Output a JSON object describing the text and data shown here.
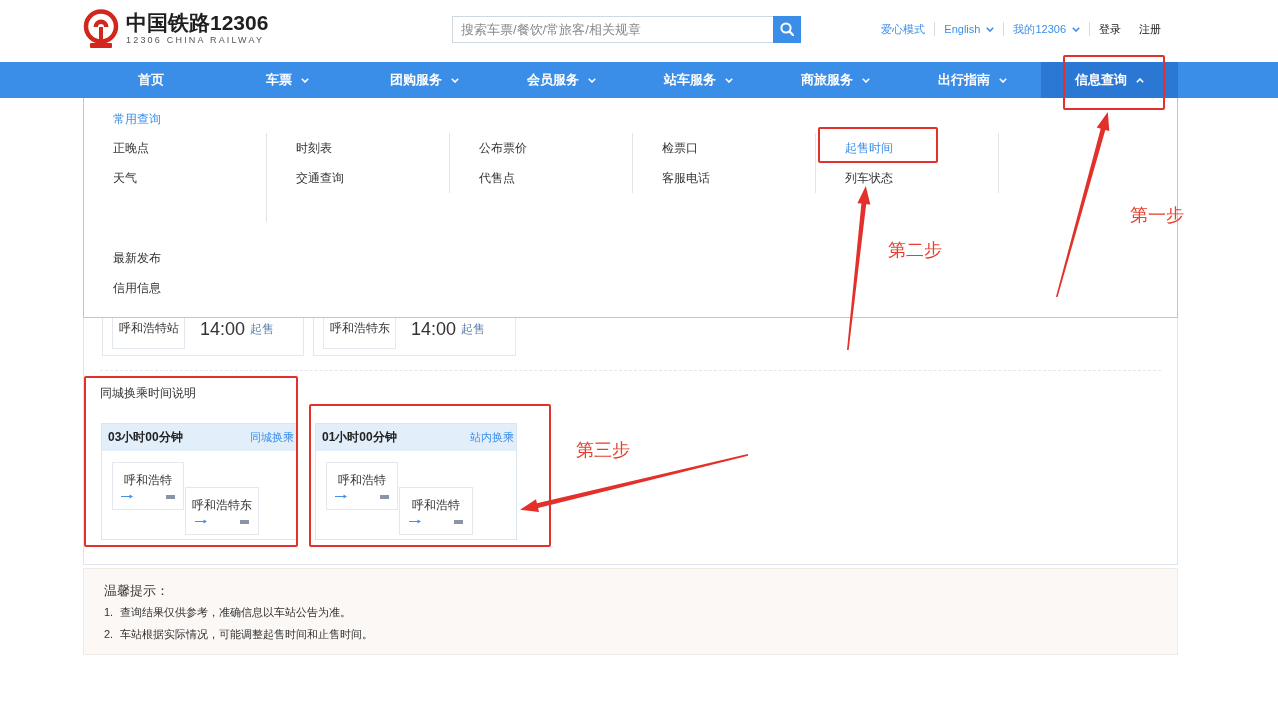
{
  "header": {
    "logo": {
      "title": "中国铁路12306",
      "subtitle": "12306 CHINA RAILWAY"
    },
    "search": {
      "placeholder": "搜索车票/餐饮/常旅客/相关规章"
    },
    "links": [
      {
        "label": "爱心模式",
        "kind": "link"
      },
      {
        "label": "English",
        "kind": "dropdown"
      },
      {
        "label": "我的12306",
        "kind": "dropdown"
      },
      {
        "label": "登录",
        "kind": "auth"
      },
      {
        "label": "注册",
        "kind": "auth"
      }
    ]
  },
  "nav": [
    {
      "label": "首页",
      "kind": "link",
      "selected": false,
      "expanded": false
    },
    {
      "label": "车票",
      "kind": "menu",
      "selected": false,
      "expanded": false
    },
    {
      "label": "团购服务",
      "kind": "menu",
      "selected": false,
      "expanded": false
    },
    {
      "label": "会员服务",
      "kind": "menu",
      "selected": false,
      "expanded": false
    },
    {
      "label": "站车服务",
      "kind": "menu",
      "selected": false,
      "expanded": false
    },
    {
      "label": "商旅服务",
      "kind": "menu",
      "selected": false,
      "expanded": false
    },
    {
      "label": "出行指南",
      "kind": "menu",
      "selected": false,
      "expanded": false
    },
    {
      "label": "信息查询",
      "kind": "menu",
      "selected": true,
      "expanded": true
    }
  ],
  "dropdown": {
    "heading": "常用查询",
    "columns": [
      {
        "items": [
          {
            "label": "正晚点",
            "selected": false
          },
          {
            "label": "天气",
            "selected": false
          }
        ]
      },
      {
        "items": [
          {
            "label": "时刻表",
            "selected": false
          },
          {
            "label": "交通查询",
            "selected": false
          }
        ]
      },
      {
        "items": [
          {
            "label": "公布票价",
            "selected": false
          },
          {
            "label": "代售点",
            "selected": false
          }
        ]
      },
      {
        "items": [
          {
            "label": "检票口",
            "selected": false
          },
          {
            "label": "客服电话",
            "selected": false
          }
        ]
      },
      {
        "items": [
          {
            "label": "起售时间",
            "selected": true
          },
          {
            "label": "列车状态",
            "selected": false
          }
        ]
      }
    ],
    "more": [
      {
        "label": "最新发布",
        "selected": false
      },
      {
        "label": "信用信息",
        "selected": false
      }
    ]
  },
  "sale_cards": [
    {
      "station": "呼和浩特站",
      "time": "14:00",
      "suffix": "起售"
    },
    {
      "station": "呼和浩特东",
      "time": "14:00",
      "suffix": "起售"
    }
  ],
  "transfer": {
    "title": "同城换乘时间说明",
    "cards": [
      {
        "duration": "03小时00分钟",
        "type_label": "同城换乘",
        "stations": [
          "呼和浩特",
          "呼和浩特东"
        ]
      },
      {
        "duration": "01小时00分钟",
        "type_label": "站内换乘",
        "stations": [
          "呼和浩特",
          "呼和浩特"
        ]
      }
    ]
  },
  "tips": {
    "title": "温馨提示：",
    "items": [
      {
        "number": "1.",
        "text": "查询结果仅供参考，准确信息以车站公告为准。"
      },
      {
        "number": "2.",
        "text": "车站根据实际情况，可能调整起售时间和止售时间。"
      }
    ]
  },
  "annotations": [
    {
      "label": "第一步"
    },
    {
      "label": "第二步"
    },
    {
      "label": "第三步"
    }
  ]
}
